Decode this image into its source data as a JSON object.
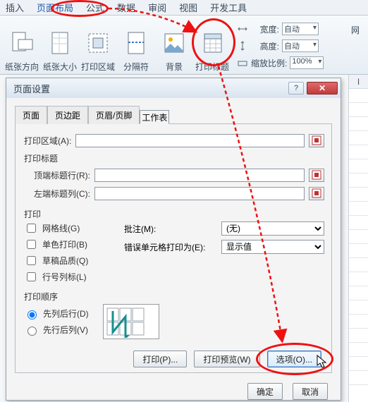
{
  "ribbon": {
    "tabs": [
      "插入",
      "页面布局",
      "公式",
      "数据",
      "审阅",
      "视图",
      "开发工具"
    ],
    "active": "页面布局",
    "items": [
      {
        "label": "纸张方向"
      },
      {
        "label": "纸张大小"
      },
      {
        "label": "打印区域"
      },
      {
        "label": "分隔符"
      },
      {
        "label": "背景"
      },
      {
        "label": "打印标题"
      }
    ],
    "width_label": "宽度:",
    "height_label": "高度:",
    "scale_label": "缩放比例:",
    "auto": "自动",
    "scale_value": "100%",
    "net_label": "网"
  },
  "dialog": {
    "title": "页面设置",
    "help": "?",
    "close": "✕",
    "tabs": [
      "页面",
      "页边距",
      "页眉/页脚",
      "工作表"
    ],
    "selected_tab": 3,
    "print_area_label": "打印区域(A):",
    "print_title_label": "打印标题",
    "top_title_label": "顶端标题行(R):",
    "left_title_label": "左端标题列(C):",
    "print_section": "打印",
    "chk_gridlines": "网格线(G)",
    "chk_mono": "单色打印(B)",
    "chk_draft": "草稿品质(Q)",
    "chk_rowcol": "行号列标(L)",
    "comments_label": "批注(M):",
    "errors_label": "错误单元格打印为(E):",
    "comments_value": "(无)",
    "errors_value": "显示值",
    "order_section": "打印顺序",
    "order_down": "先列后行(D)",
    "order_over": "先行后列(V)",
    "btn_print": "打印(P)...",
    "btn_preview": "打印预览(W)",
    "btn_options": "选项(O)...",
    "btn_ok": "确定",
    "btn_cancel": "取消"
  },
  "sheet_col": "I"
}
